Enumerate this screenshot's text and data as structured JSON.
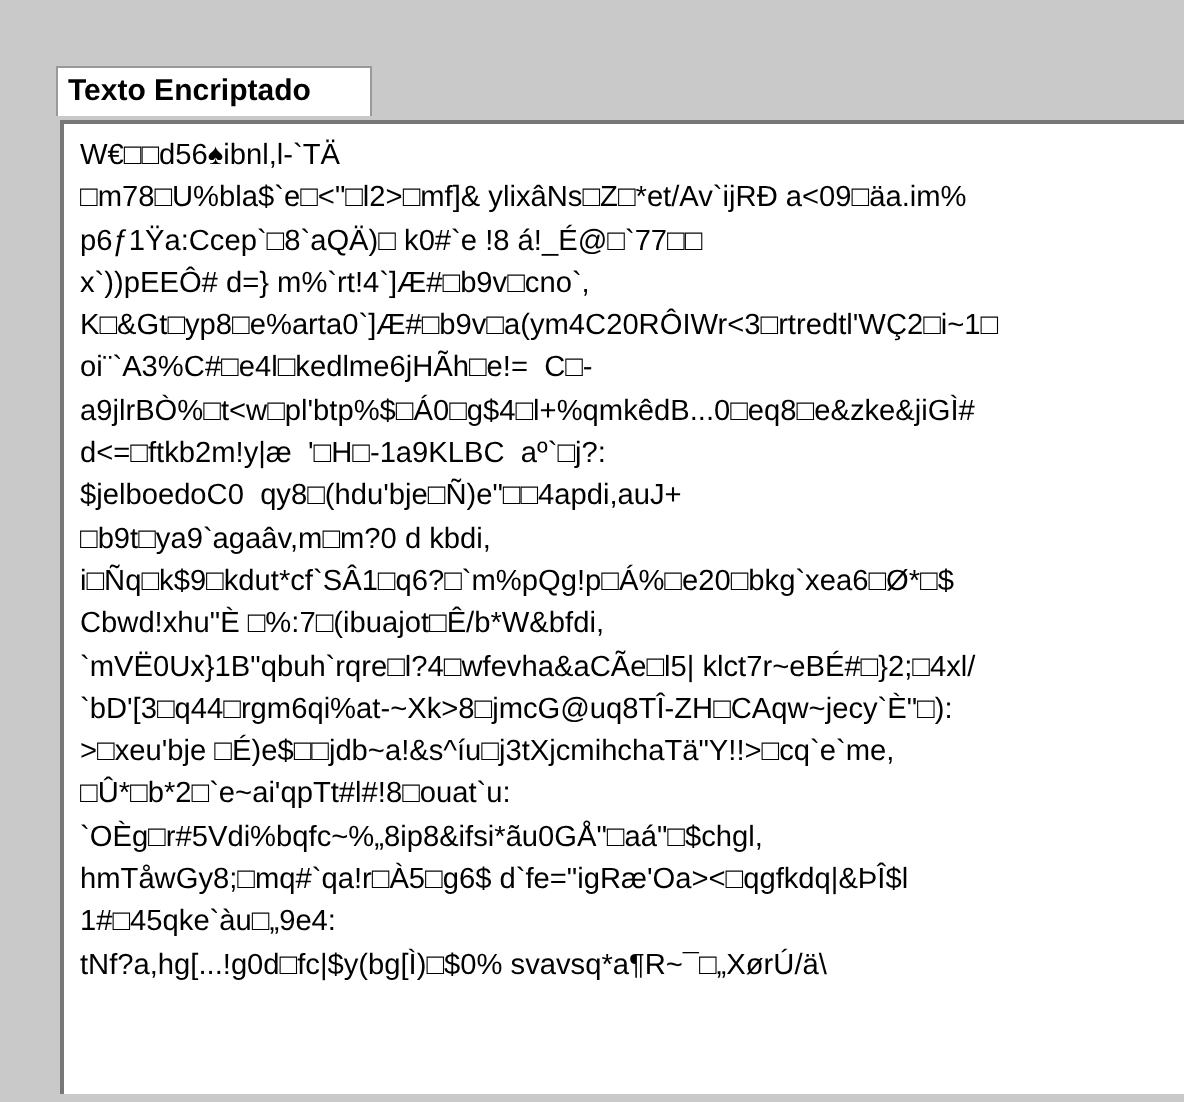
{
  "label": "Texto Encriptado",
  "text_lines": [
    "W€□□d56♠ibnl,l-`TÄ",
    "□m78□U%bla$`e□<\"□l2>□mf]& ylixâNs□Z□*et/Av`ijRÐ a<09□äa.im%",
    "p6ƒ1Ÿa:Ccep`□8`aQÄ)□ k0#`e !8 á!_É@□`77□□",
    "x`))pEEÔ# d=} m%`rt!4`]Æ#□b9v□cno`,",
    "K□&Gt□yp8□e%arta0`]Æ#□b9v□a(ym4C20RÔIWr<3□rtredtl'WÇ2□i~1□",
    "oi¨`A3%C#□e4l□kedlme6jHÃh□e!=  C□-",
    "a9jlrBÒ%□t<w□pl'btp%$□Á0□g$4□l+%qmkêdB...0□eq8□e&zke&jiGÌ#",
    "d<=□ftkb2m!y|æ  '□H□-1a9KLBC  aº`□j?:",
    "$jelboedoC0  qy8□(hdu'bje□Ñ)e\"□□4apdi,auJ+",
    "□b9t□ya9`agaâv,m□m?0 d kbdi,",
    "i□Ñq□k$9□kdut*cf`SÂ1□q6?□`m%pQg!p□Á%□e20□bkg`xea6□Ø*□$",
    "Cbwd!xhu\"È □%:7□(ibuajot□Ê/b*W&bfdi,",
    "`mVË0Ux}1B\"qbuh`rqre□l?4□wfevha&aCÃe□l5| klct7r~eBÉ#□}2;□4xl/",
    "`bD'[3□q44□rgm6qi%at-~Xk>8□jmcG@uq8TÎ-ZH□CAqw~jecy`È\"□):",
    ">□xeu'bje □É)e$□□jdb~a!&s^íu□j3tXjcmihchaTä\"Y!!>□cq`e`me,",
    "□Û*□b*2□`e~ai'qpTt#l#!8□ouat`u:",
    "`OÈg□r#5Vdi%bqfc~%„8ip8&ifsi*ãu0GÅ\"□aá\"□$chgl,",
    "hmTåwGy8;□mq#`qa!r□À5□g6$ d`fe=\"igRæ'Oa><□qgfkdq|&ÞÎ$l",
    "1#□45qke`àu□„9e4:",
    "tNf?a,hg[...!g0d□fc|$y(bg[Ì)□$0% svavsq*a¶R~¯□„XørÚ/ä\\"
  ]
}
